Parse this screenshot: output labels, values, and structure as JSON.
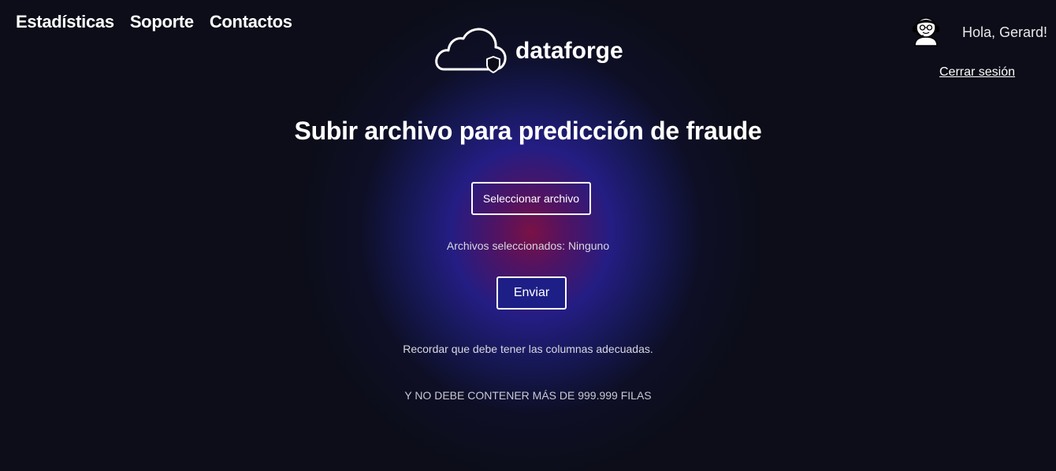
{
  "nav": {
    "items": [
      {
        "label": "Estadísticas"
      },
      {
        "label": "Soporte"
      },
      {
        "label": "Contactos"
      }
    ]
  },
  "brand": {
    "name": "dataforge",
    "icon": "cloud-shield-icon"
  },
  "user": {
    "greeting": "Hola, Gerard!",
    "logout_label": "Cerrar sesión",
    "avatar_icon": "support-agent-avatar-icon"
  },
  "main": {
    "title": "Subir archivo para predicción de fraude",
    "select_button": "Seleccionar archivo",
    "selected_files": "Archivos seleccionados: Ninguno",
    "send_button": "Enviar",
    "note_columns": "Recordar que debe tener las columnas adecuadas.",
    "note_rows": "Y NO DEBE CONTENER MÁS DE 999.999 FILAS"
  },
  "colors": {
    "background": "#0c0d18",
    "glow_blue": "#2a20a0",
    "glow_magenta": "#801248",
    "send_button_bg": "#1d1f86"
  }
}
